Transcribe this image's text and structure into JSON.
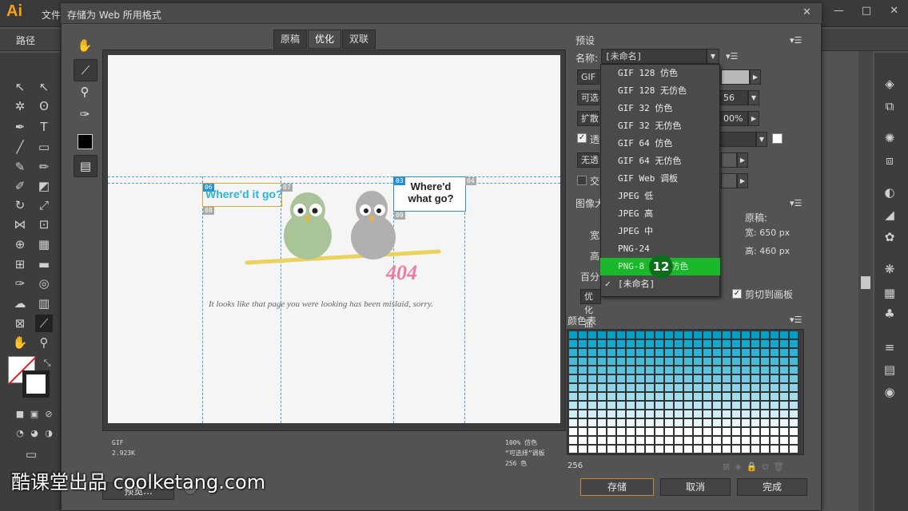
{
  "app": {
    "logo": "Ai",
    "menu_file": "文件",
    "window_controls": [
      "—",
      "□",
      "✕"
    ],
    "control_bar_label": "路径"
  },
  "dialog": {
    "title": "存储为 Web 所用格式",
    "close": "✕",
    "tabs": [
      "原稿",
      "优化",
      "双联"
    ],
    "active_tab": "优化",
    "preview": {
      "slices": [
        "06",
        "07",
        "08",
        "03",
        "04",
        "05",
        "09"
      ],
      "speech_left": "Where'd it go?",
      "speech_right_line1": "Where'd",
      "speech_right_line2": "what go?",
      "big_number": "404",
      "message": "It looks like that page you were looking has been mislaid, sorry."
    },
    "info_left": [
      "GIF",
      "2.923K"
    ],
    "info_right": [
      "100% 仿色",
      "“可选择”调板",
      "256 色"
    ],
    "preview_button": "预览...",
    "buttons": {
      "save": "存储",
      "cancel": "取消",
      "done": "完成"
    }
  },
  "settings": {
    "preset_header": "预设",
    "name_label": "名称:",
    "name_value": "[未命名]",
    "format_value": "GIF",
    "algorithm_value": "可选",
    "dither_value": "扩散",
    "colors_tail": "56",
    "dither_pct_tail": "00%",
    "transparency_label": "透",
    "no_transparency": "无透",
    "interlace_label": "交",
    "image_size_header": "图像大",
    "width_short": "宽",
    "height_short": "高",
    "percent_short": "百分",
    "quality_value": "优化品质",
    "original_label": "原稿:",
    "original_width": "宽: 650 px",
    "original_height": "高: 460 px",
    "clip_label": "剪切到画板",
    "color_table_header": "颜色表",
    "color_count": "256",
    "accent": "#2a8fd0",
    "highlight": "#1ab82b"
  },
  "dropdown": {
    "items": [
      "GIF 128 仿色",
      "GIF 128 无仿色",
      "GIF 32 仿色",
      "GIF 32 无仿色",
      "GIF 64 仿色",
      "GIF 64 无仿色",
      "GIF Web 调板",
      "JPEG 低",
      "JPEG 高",
      "JPEG 中",
      "PNG-24",
      "PNG-8 128 仿色",
      "[未命名]"
    ],
    "highlighted_index": 11,
    "checked_index": 12,
    "step_badge": "12"
  },
  "watermark": "酷课堂出品 coolketang.com"
}
